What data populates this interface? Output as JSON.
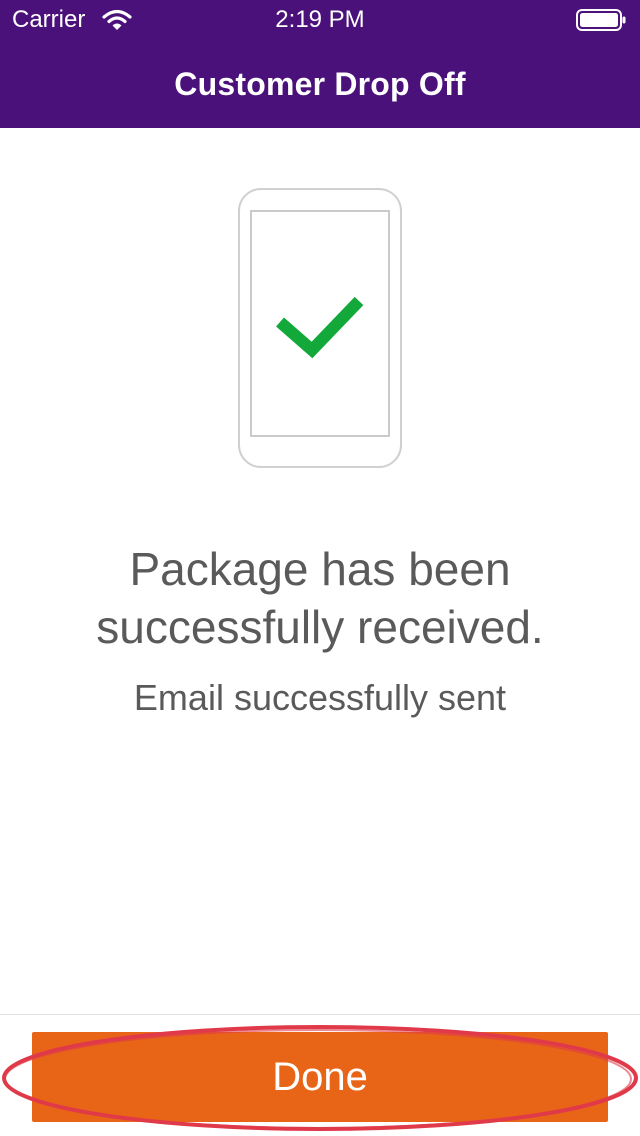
{
  "status_bar": {
    "carrier": "Carrier",
    "time": "2:19 PM",
    "wifi_icon": "wifi-icon",
    "battery_icon": "battery-icon"
  },
  "nav": {
    "title": "Customer Drop Off"
  },
  "illustration": {
    "icon": "phone-with-checkmark-icon"
  },
  "message": {
    "main": "Package has been successfully received.",
    "sub": "Email successfully sent"
  },
  "actions": {
    "done_label": "Done"
  },
  "colors": {
    "header_bg": "#4b117a",
    "done_button": "#e86518",
    "checkmark": "#12a83a",
    "annotation": "#e03a4a"
  }
}
